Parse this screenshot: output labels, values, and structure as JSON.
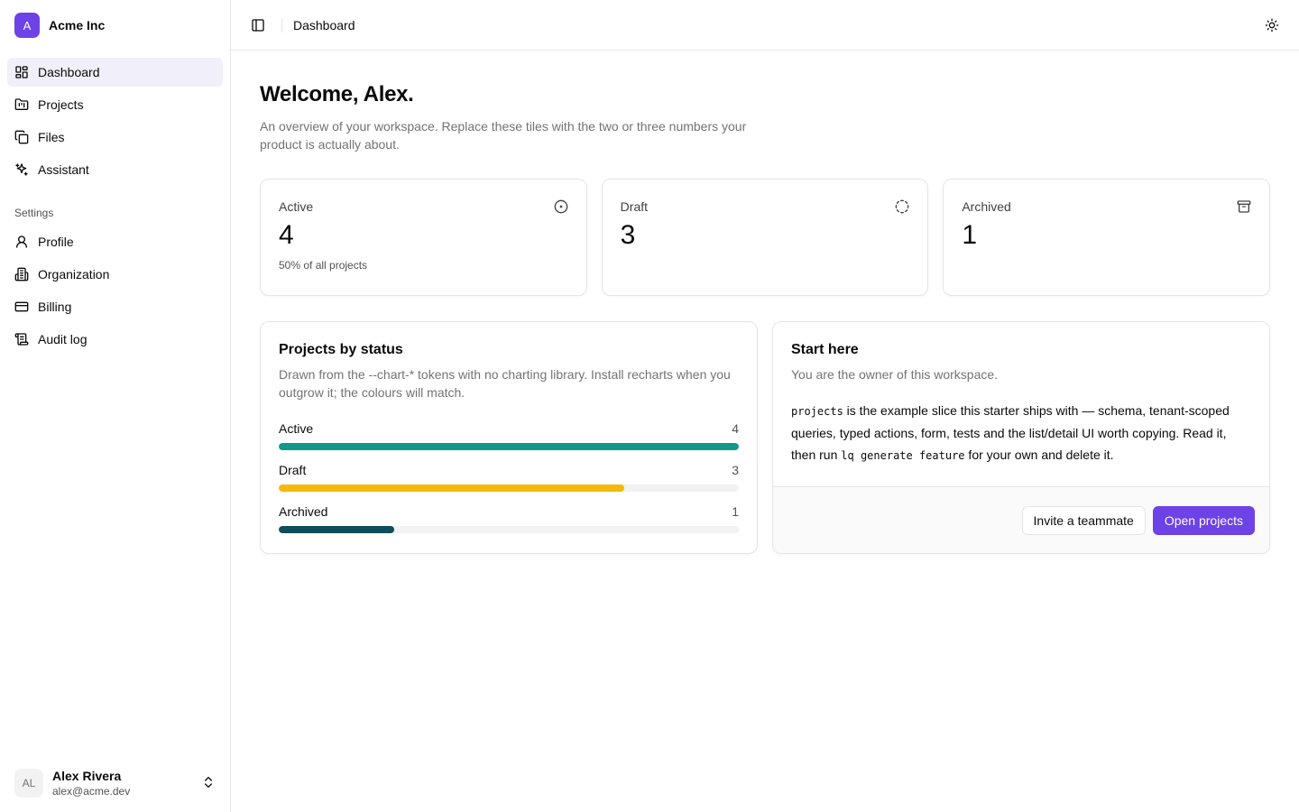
{
  "brand": {
    "logo_letter": "A",
    "name": "Acme Inc"
  },
  "sidebar": {
    "items": [
      {
        "label": "Dashboard",
        "icon": "dashboard-icon",
        "active": true
      },
      {
        "label": "Projects",
        "icon": "projects-icon"
      },
      {
        "label": "Files",
        "icon": "files-icon"
      },
      {
        "label": "Assistant",
        "icon": "sparkles-icon"
      }
    ],
    "settings_label": "Settings",
    "settings_items": [
      {
        "label": "Profile",
        "icon": "user-icon"
      },
      {
        "label": "Organization",
        "icon": "building-icon"
      },
      {
        "label": "Billing",
        "icon": "credit-card-icon"
      },
      {
        "label": "Audit log",
        "icon": "scroll-icon"
      }
    ]
  },
  "user": {
    "initials": "AL",
    "name": "Alex Rivera",
    "email": "alex@acme.dev"
  },
  "topbar": {
    "breadcrumb": "Dashboard"
  },
  "page": {
    "title": "Welcome, Alex.",
    "subtitle": "An overview of your workspace. Replace these tiles with the two or three numbers your product is actually about."
  },
  "stats": [
    {
      "label": "Active",
      "value": "4",
      "note": "50% of all projects",
      "icon": "circle-dot-icon"
    },
    {
      "label": "Draft",
      "value": "3",
      "note": "",
      "icon": "circle-dashed-icon"
    },
    {
      "label": "Archived",
      "value": "1",
      "note": "",
      "icon": "archive-icon"
    }
  ],
  "status_card": {
    "title": "Projects by status",
    "description": "Drawn from the --chart-* tokens with no charting library. Install recharts when you outgrow it; the colours will match.",
    "rows": [
      {
        "label": "Active",
        "count": "4",
        "fraction": 1.0,
        "color": "#10998a"
      },
      {
        "label": "Draft",
        "count": "3",
        "fraction": 0.75,
        "color": "#f5b80b"
      },
      {
        "label": "Archived",
        "count": "1",
        "fraction": 0.25,
        "color": "#0f4d5c"
      }
    ]
  },
  "start_card": {
    "title": "Start here",
    "description": "You are the owner of this workspace.",
    "text_code1": "projects",
    "text_part1": " is the example slice this starter ships with — schema, tenant-scoped queries, typed actions, form, tests and the list/detail UI worth copying. Read it, then run ",
    "text_code2": "lq generate feature",
    "text_part2": " for your own and delete it.",
    "invite_label": "Invite a teammate",
    "open_label": "Open projects"
  },
  "colors": {
    "accent": "#6d42e6",
    "active_nav_bg": "#f0effa",
    "border": "#e5e5e5"
  }
}
